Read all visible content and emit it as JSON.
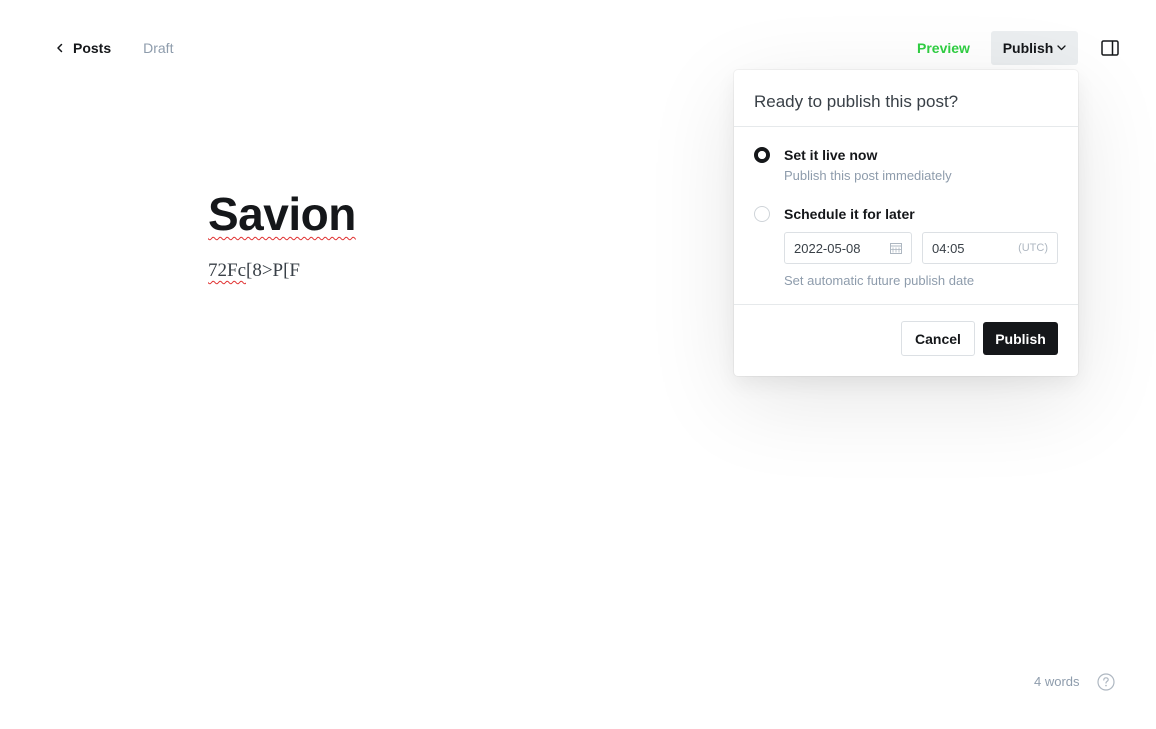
{
  "header": {
    "back_label": "Posts",
    "status": "Draft",
    "preview_label": "Preview",
    "publish_label": "Publish"
  },
  "editor": {
    "title": "Savion",
    "body_misspelled": "72Fc",
    "body_rest": "[8>P[F"
  },
  "publish_menu": {
    "heading": "Ready to publish this post?",
    "options": [
      {
        "label": "Set it live now",
        "hint": "Publish this post immediately",
        "selected": true
      },
      {
        "label": "Schedule it for later",
        "selected": false
      }
    ],
    "date_value": "2022-05-08",
    "time_value": "04:05",
    "timezone": "(UTC)",
    "schedule_hint": "Set automatic future publish date",
    "cancel_label": "Cancel",
    "publish_label": "Publish"
  },
  "footer": {
    "word_count": "4 words"
  },
  "colors": {
    "accent_green": "#30cf43",
    "dark": "#15171a",
    "muted": "#8e9cac"
  }
}
